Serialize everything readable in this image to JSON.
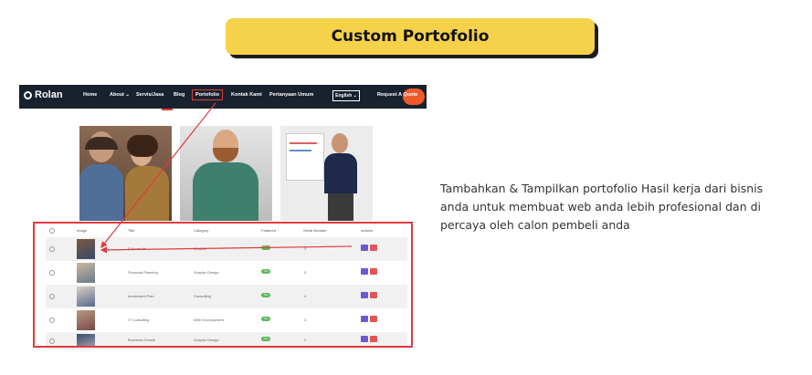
{
  "title": "Custom Portofolio",
  "site": {
    "logo": "Rolan",
    "nav": [
      "Home",
      "About",
      "Servis/Jasa",
      "Blog",
      "Portofolio",
      "Kontak Kami",
      "Pertanyaan Umum"
    ],
    "language": "English",
    "cta": "Request A Quote"
  },
  "table": {
    "headers": [
      "Image",
      "Title",
      "Category",
      "Featured",
      "Serial Number",
      "Actions"
    ],
    "rows": [
      {
        "title": "Edit results",
        "category": "Graphic",
        "featured": "Yes",
        "serial": "3"
      },
      {
        "title": "Financial Planning",
        "category": "Graphic Design",
        "featured": "Yes",
        "serial": "5"
      },
      {
        "title": "Investment Plan",
        "category": "Consulting",
        "featured": "Yes",
        "serial": "4"
      },
      {
        "title": "IT Consulting",
        "category": "Web Development",
        "featured": "Yes",
        "serial": "4"
      },
      {
        "title": "Business Growth",
        "category": "Graphic Design",
        "featured": "Yes",
        "serial": "2"
      }
    ]
  },
  "description": [
    "Tambahkan & Tampilkan portofolio Hasil kerja dari bisnis",
    "anda untuk membuat web anda lebih profesional dan di",
    "percaya oleh calon pembeli anda"
  ],
  "colors": {
    "accent": "#f6d24a",
    "highlight": "#e03b3b",
    "nav_bg": "#18222e",
    "cta": "#ee5a2b"
  }
}
